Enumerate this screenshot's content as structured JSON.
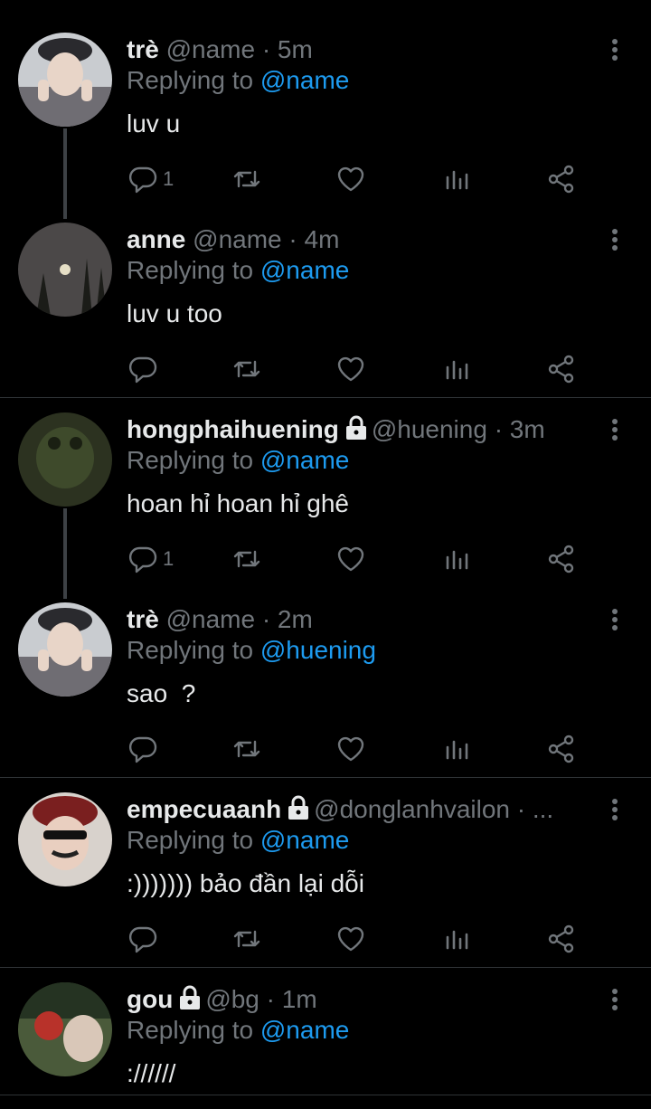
{
  "tweets": [
    {
      "name": "trè",
      "handle": "@name",
      "time": "· 5m",
      "reply_prefix": "Replying to",
      "reply_to": "@name",
      "text": "luv u",
      "reply_count": "1"
    },
    {
      "name": "anne",
      "handle": "@name",
      "time": "· 4m",
      "reply_prefix": "Replying to",
      "reply_to": "@name",
      "text": "luv u too",
      "reply_count": ""
    },
    {
      "name": "hongphaihuening",
      "handle": "@huening",
      "time": "· 3m",
      "reply_prefix": "Replying to",
      "reply_to": "@name",
      "text": "hoan hỉ hoan hỉ ghê",
      "reply_count": "1"
    },
    {
      "name": "trè",
      "handle": "@name",
      "time": "· 2m",
      "reply_prefix": "Replying to",
      "reply_to": "@huening",
      "text": "sao  ?",
      "reply_count": ""
    },
    {
      "name": "empecuaanh",
      "handle": "@donglanhvailon",
      "time": "· ...",
      "reply_prefix": "Replying to",
      "reply_to": "@name",
      "text": ":))))))) bảo đần lại dỗi",
      "reply_count": ""
    },
    {
      "name": "gou",
      "handle": "@bg",
      "time": "· 1m",
      "reply_prefix": "Replying to",
      "reply_to": "@name",
      "text": "://////",
      "reply_count": ""
    }
  ],
  "icons": {
    "reply": "reply-icon",
    "retweet": "retweet-icon",
    "like": "heart-icon",
    "analytics": "analytics-icon",
    "share": "share-icon",
    "more": "more-vertical-icon",
    "lock": "lock-icon"
  },
  "colors": {
    "background": "#000000",
    "text": "#e7e9ea",
    "muted": "#71767b",
    "link": "#1d9bf0",
    "divider": "#2f3336"
  }
}
